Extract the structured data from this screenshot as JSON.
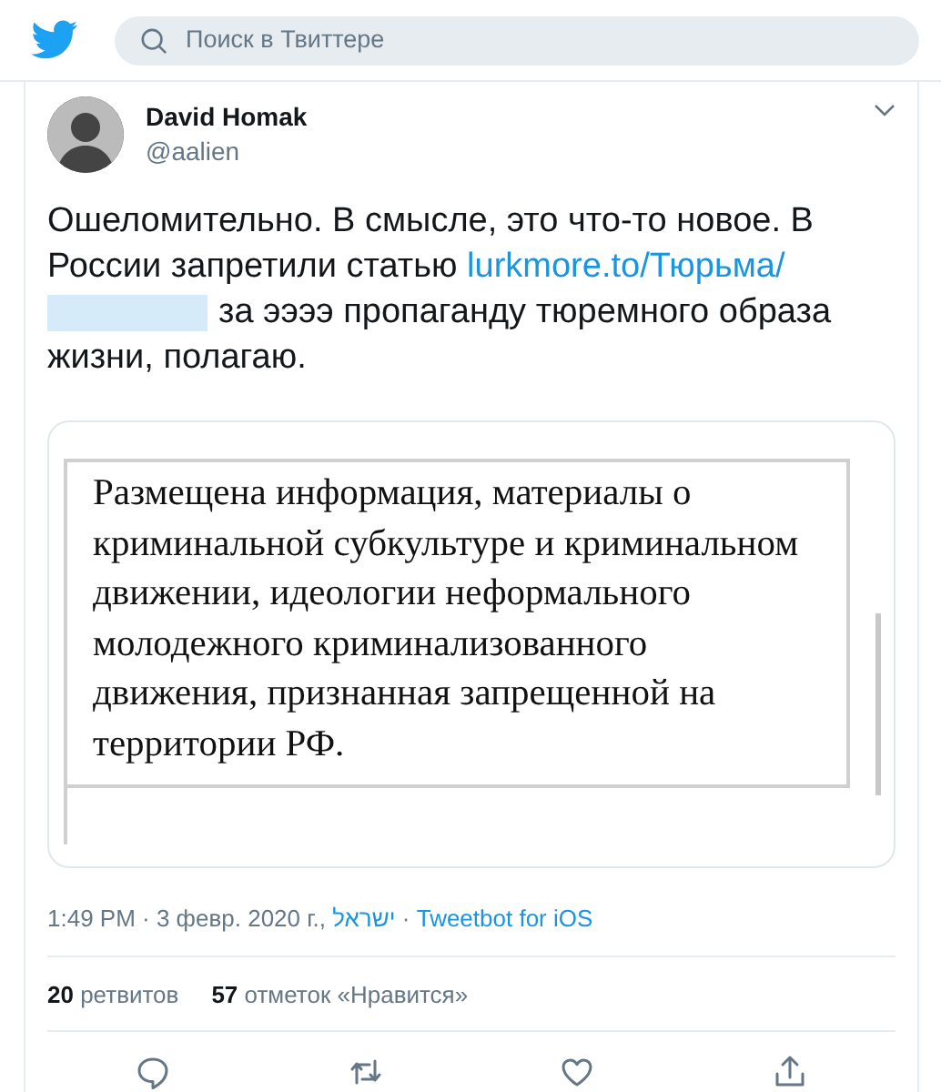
{
  "header": {
    "search_placeholder": "Поиск в Твиттере"
  },
  "tweet": {
    "author": {
      "name": "David Homak",
      "handle": "@aalien"
    },
    "text": "Ошеломительно. В смысле, это что-то новое. В России запретили статью ",
    "link": "lurkmore.to/Тюрьма/",
    "link_redacted": true,
    "text_after": "за ээээ пропаганду тюремного образа жизни, полагаю.",
    "embedded_document": {
      "text": "Размещена информация, материалы о криминальной субкультуре и криминальном движении, идеологии неформального молодежного криминализованного движения, признанная запрещенной на территории РФ."
    },
    "timestamp": "1:49 PM · 3 февр. 2020 г.,",
    "location": "ישראל",
    "separator": "·",
    "source": "Tweetbot for iOS",
    "stats": [
      {
        "count": "20",
        "label": "ретвитов"
      },
      {
        "count": "57",
        "label": "отметок «Нравится»"
      }
    ],
    "actions": [
      {
        "kind": "reply"
      },
      {
        "kind": "retweet"
      },
      {
        "kind": "like"
      },
      {
        "kind": "share"
      }
    ]
  }
}
